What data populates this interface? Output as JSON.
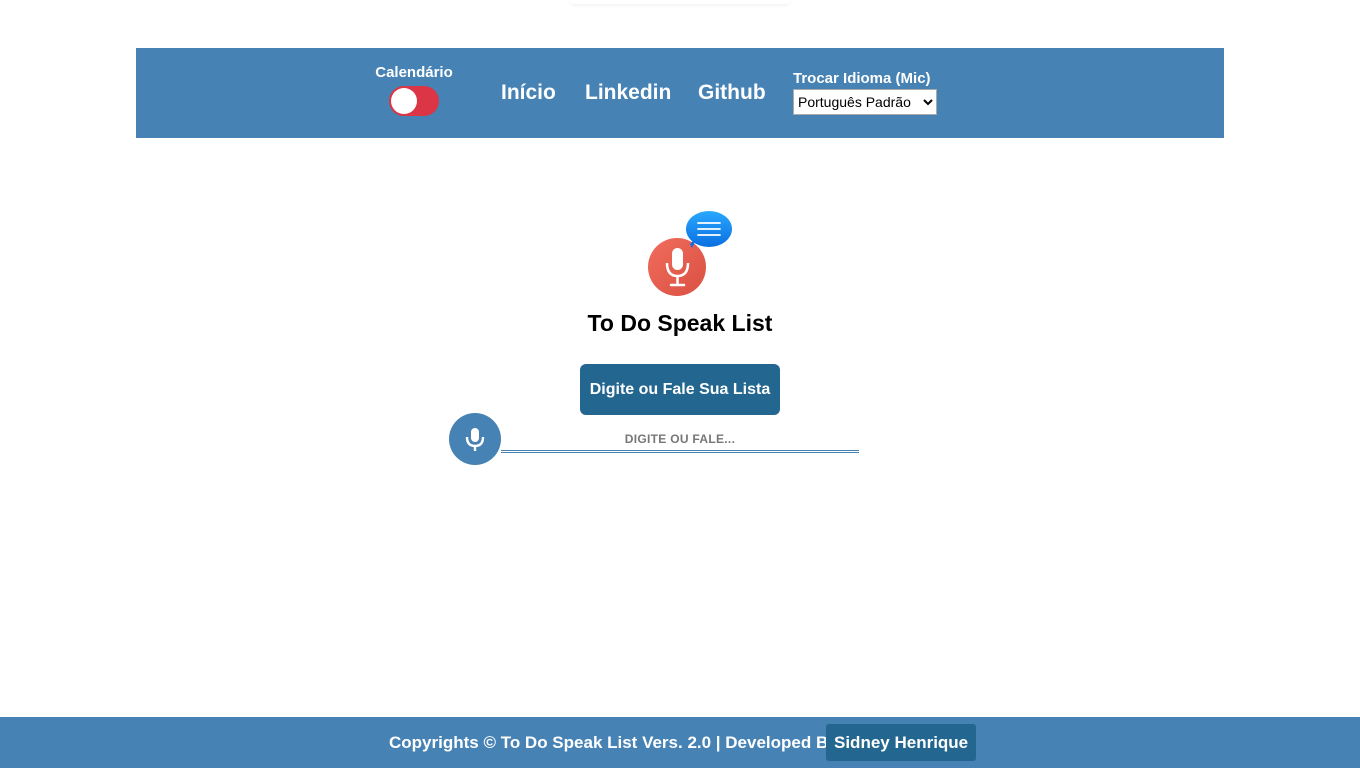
{
  "navbar": {
    "calendar_label": "Calendário",
    "calendar_toggle_on": false,
    "links": {
      "home": "Início",
      "linkedin": "Linkedin",
      "github": "Github"
    },
    "language_label": "Trocar Idioma (Mic)",
    "language_selected": "Português Padrão"
  },
  "main": {
    "logo_icon": "microphone-speech-bubble-icon",
    "title": "To Do Speak List",
    "button_label": "Digite ou Fale Sua Lista",
    "mic_icon": "microphone-icon",
    "input_placeholder": "DIGITE OU FALE...",
    "input_value": ""
  },
  "footer": {
    "text": "Copyrights © To Do Speak List Vers. 2.0 | Developed By",
    "author": "Sidney Henrique"
  },
  "colors": {
    "primary": "#4682b4",
    "primary_dark": "#23668f",
    "toggle_off": "#dc3545",
    "logo_red": "#f15a4a",
    "logo_blue": "#1e90ff"
  }
}
